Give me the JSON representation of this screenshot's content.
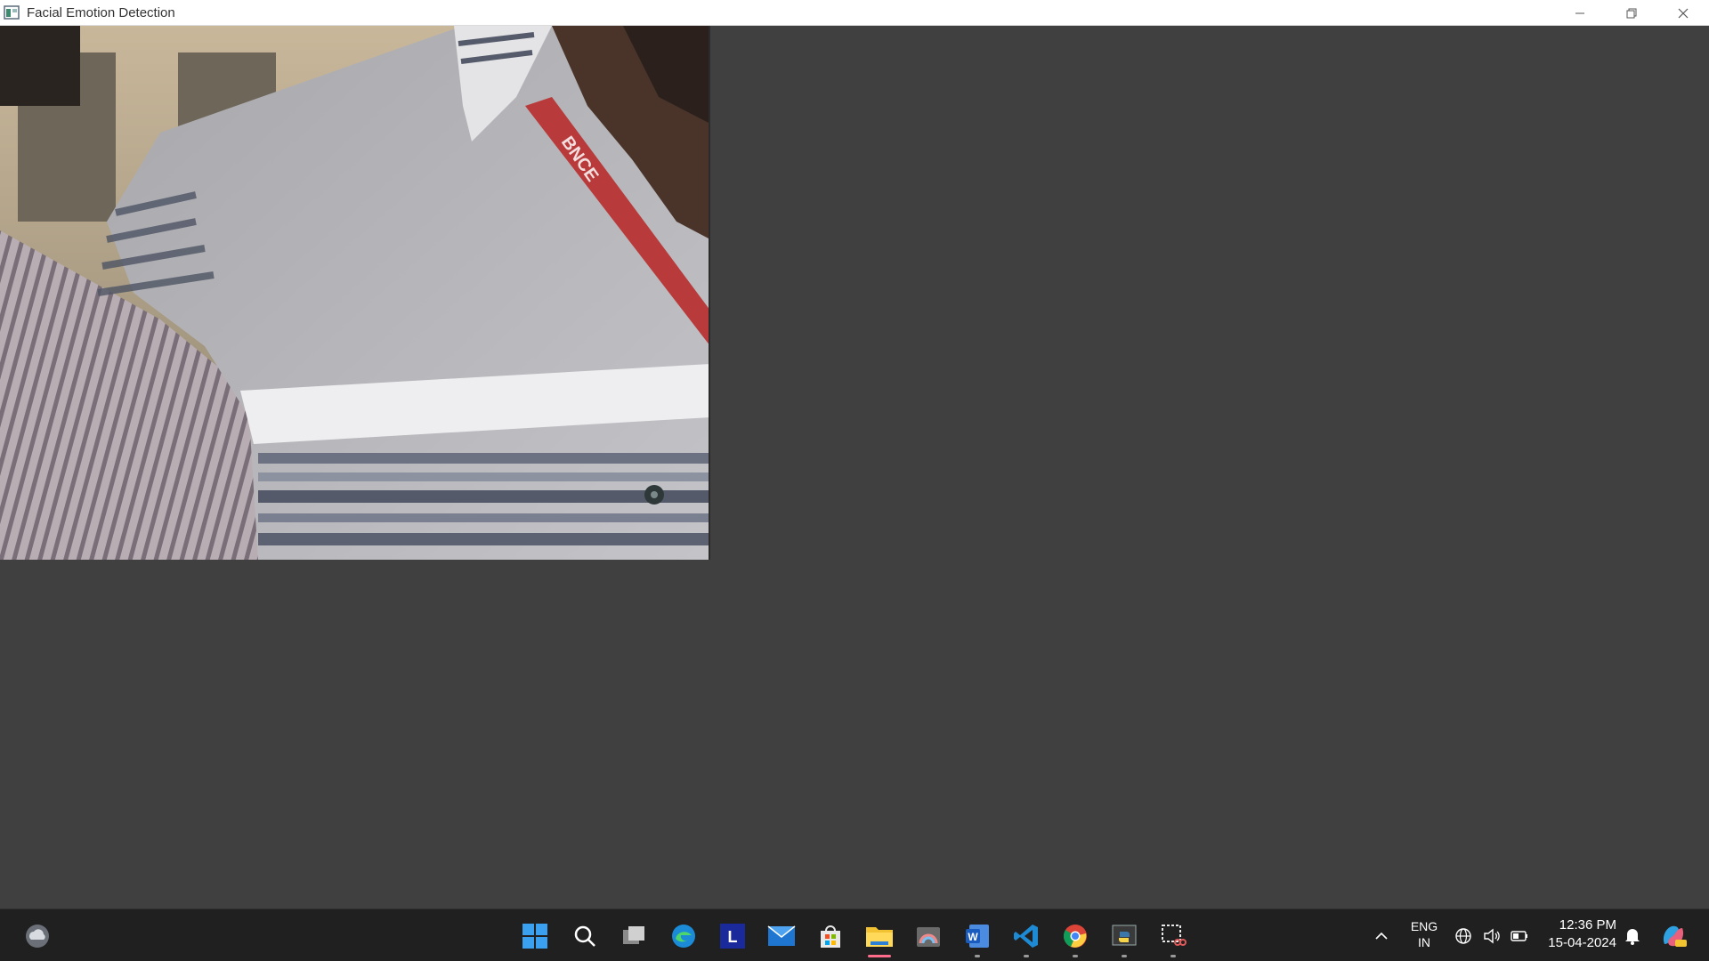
{
  "window": {
    "title": "Facial Emotion Detection",
    "controls": [
      "minimize-icon",
      "restore-icon",
      "close-icon"
    ]
  },
  "video": {
    "content": "webcam feed showing person in grey striped polo shirt with red lanyard",
    "lanyard_text": "BNCE"
  },
  "taskbar": {
    "widgets_icon": "weather-cloud-icon",
    "pinned": [
      {
        "name": "start-icon",
        "running": false
      },
      {
        "name": "search-icon",
        "running": false
      },
      {
        "name": "task-view-icon",
        "running": false
      },
      {
        "name": "edge-icon",
        "running": false
      },
      {
        "name": "l-app-icon",
        "label": "L",
        "running": false
      },
      {
        "name": "mail-icon",
        "running": false
      },
      {
        "name": "store-icon",
        "running": false
      },
      {
        "name": "file-explorer-icon",
        "running": true,
        "active": true
      },
      {
        "name": "photos-icon",
        "running": false
      },
      {
        "name": "word-icon",
        "label": "W",
        "running": true
      },
      {
        "name": "vscode-icon",
        "running": true
      },
      {
        "name": "chrome-icon",
        "running": true
      },
      {
        "name": "python-icon",
        "running": true
      },
      {
        "name": "snipping-tool-icon",
        "running": true
      }
    ],
    "tray": {
      "language_line1": "ENG",
      "language_line2": "IN",
      "time": "12:36 PM",
      "date": "15-04-2024"
    }
  },
  "colors": {
    "client_bg": "#404040",
    "taskbar_bg": "#202020",
    "titlebar_bg": "#ffffff"
  }
}
